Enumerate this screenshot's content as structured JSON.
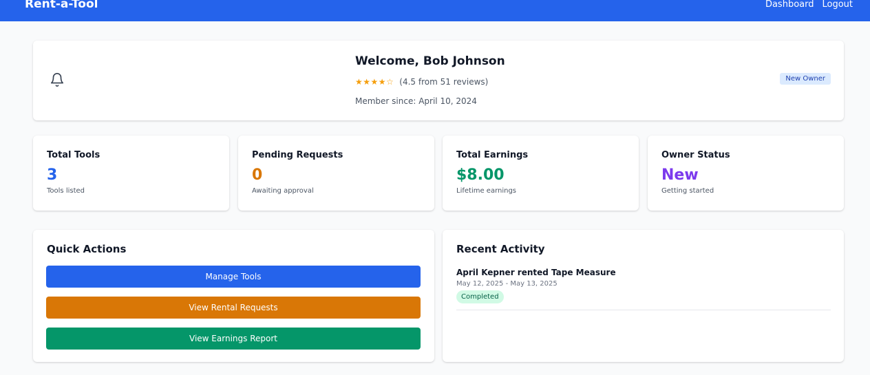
{
  "nav": {
    "brand": "Rent-a-Tool",
    "links": [
      "Dashboard",
      "Logout"
    ]
  },
  "welcome": {
    "title": "Welcome, Bob Johnson",
    "stars": "★★★★☆",
    "rating_text": "(4.5 from 51 reviews)",
    "member_since": "Member since: April 10, 2024",
    "badge": "New Owner"
  },
  "stats": [
    {
      "title": "Total Tools",
      "value": "3",
      "sub": "Tools listed",
      "color": "#2563eb"
    },
    {
      "title": "Pending Requests",
      "value": "0",
      "sub": "Awaiting approval",
      "color": "#d97706"
    },
    {
      "title": "Total Earnings",
      "value": "$8.00",
      "sub": "Lifetime earnings",
      "color": "#059669"
    },
    {
      "title": "Owner Status",
      "value": "New",
      "sub": "Getting started",
      "color": "#7c3aed"
    }
  ],
  "quick_actions": {
    "title": "Quick Actions",
    "buttons": [
      "Manage Tools",
      "View Rental Requests",
      "View Earnings Report"
    ]
  },
  "recent_activity": {
    "title": "Recent Activity",
    "items": [
      {
        "title": "April Kepner rented Tape Measure",
        "dates": "May 12, 2025 - May 13, 2025",
        "status": "Completed"
      }
    ]
  },
  "icons": {
    "bell": "bell-icon"
  },
  "colors": {
    "primary": "#2563eb",
    "warning": "#d97706",
    "success": "#059669",
    "purple": "#7c3aed"
  }
}
